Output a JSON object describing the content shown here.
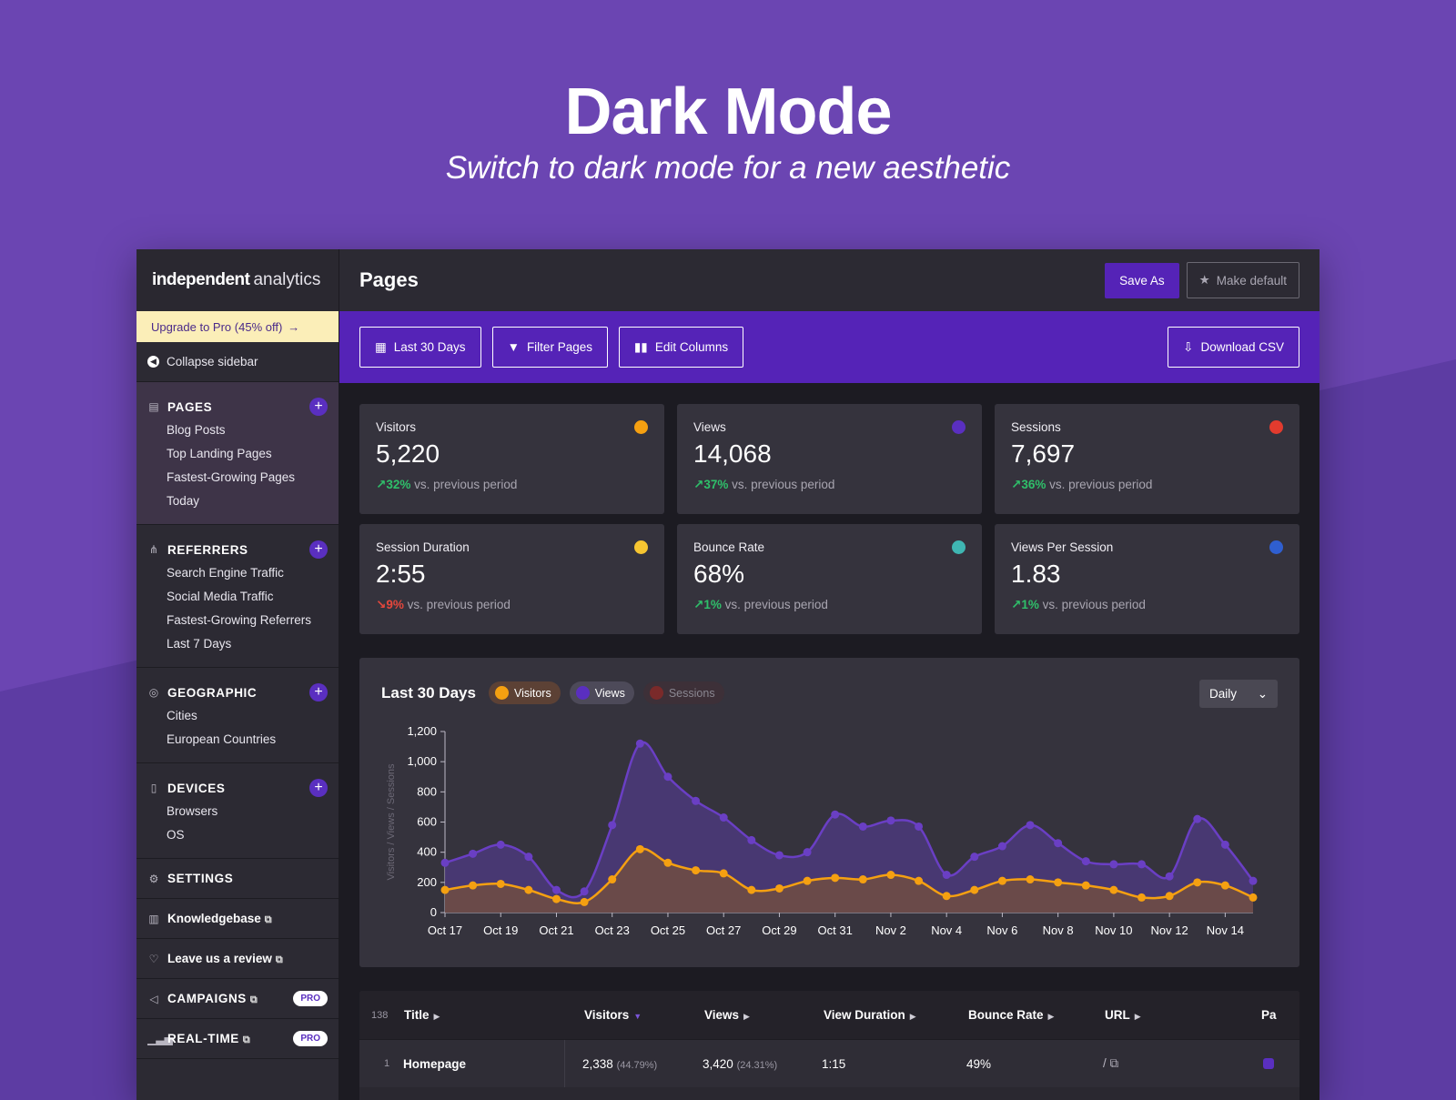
{
  "hero": {
    "title": "Dark Mode",
    "subtitle": "Switch to dark mode for a new aesthetic"
  },
  "sidebar": {
    "logo_bold": "independent",
    "logo_light": "analytics",
    "upgrade": "Upgrade to Pro (45% off)",
    "collapse": "Collapse sidebar",
    "sections": [
      {
        "title": "PAGES",
        "icon": "page-icon",
        "items": [
          "Blog Posts",
          "Top Landing Pages",
          "Fastest-Growing Pages",
          "Today"
        ]
      },
      {
        "title": "REFERRERS",
        "icon": "referrers-icon",
        "items": [
          "Search Engine Traffic",
          "Social Media Traffic",
          "Fastest-Growing Referrers",
          "Last 7 Days"
        ]
      },
      {
        "title": "GEOGRAPHIC",
        "icon": "globe-icon",
        "items": [
          "Cities",
          "European Countries"
        ]
      },
      {
        "title": "DEVICES",
        "icon": "devices-icon",
        "items": [
          "Browsers",
          "OS"
        ]
      }
    ],
    "settings": "SETTINGS",
    "knowledgebase": "Knowledgebase",
    "review": "Leave us a review",
    "campaigns": "CAMPAIGNS",
    "realtime": "REAL-TIME",
    "pro_badge": "PRO"
  },
  "header": {
    "title": "Pages",
    "save_as": "Save As",
    "make_default": "Make default"
  },
  "toolbar": {
    "date_range": "Last 30 Days",
    "filter": "Filter Pages",
    "columns": "Edit Columns",
    "download": "Download CSV"
  },
  "stats": [
    {
      "label": "Visitors",
      "value": "5,220",
      "change": "32%",
      "direction": "up",
      "suffix": "vs. previous period",
      "color": "#f5a011"
    },
    {
      "label": "Views",
      "value": "14,068",
      "change": "37%",
      "direction": "up",
      "suffix": "vs. previous period",
      "color": "#5a2fc0"
    },
    {
      "label": "Sessions",
      "value": "7,697",
      "change": "36%",
      "direction": "up",
      "suffix": "vs. previous period",
      "color": "#e23b2e"
    },
    {
      "label": "Session Duration",
      "value": "2:55",
      "change": "9%",
      "direction": "down",
      "suffix": "vs. previous period",
      "color": "#f6c531"
    },
    {
      "label": "Bounce Rate",
      "value": "68%",
      "change": "1%",
      "direction": "up",
      "suffix": "vs. previous period",
      "color": "#3fb6b2"
    },
    {
      "label": "Views Per Session",
      "value": "1.83",
      "change": "1%",
      "direction": "up",
      "suffix": "vs. previous period",
      "color": "#2f5fd0"
    }
  ],
  "chart_panel": {
    "title": "Last 30 Days",
    "legend": [
      {
        "name": "Visitors",
        "color": "#f5a011",
        "bg": "#5c4135",
        "text": "#ffffff",
        "active": true
      },
      {
        "name": "Views",
        "color": "#5a2fc0",
        "bg": "#4d4a59",
        "text": "#ffffff",
        "active": true
      },
      {
        "name": "Sessions",
        "color": "#7a2a2a",
        "bg": "#3d3038",
        "text": "#8a8791",
        "active": false
      }
    ],
    "interval": "Daily"
  },
  "chart_data": {
    "type": "area",
    "ylabel": "Visitors / Views / Sessions",
    "ylim": [
      0,
      1200
    ],
    "yticks": [
      0,
      200,
      400,
      600,
      800,
      1000,
      1200
    ],
    "ytick_labels": [
      "0",
      "200",
      "400",
      "600",
      "800",
      "1,000",
      "1,200"
    ],
    "x": [
      "Oct 17",
      "Oct 18",
      "Oct 19",
      "Oct 20",
      "Oct 21",
      "Oct 22",
      "Oct 23",
      "Oct 24",
      "Oct 25",
      "Oct 26",
      "Oct 27",
      "Oct 28",
      "Oct 29",
      "Oct 30",
      "Oct 31",
      "Nov 1",
      "Nov 2",
      "Nov 3",
      "Nov 4",
      "Nov 5",
      "Nov 6",
      "Nov 7",
      "Nov 8",
      "Nov 9",
      "Nov 10",
      "Nov 11",
      "Nov 12",
      "Nov 13",
      "Nov 14",
      "Nov 15"
    ],
    "xtick_labels": [
      "Oct 17",
      "Oct 19",
      "Oct 21",
      "Oct 23",
      "Oct 25",
      "Oct 27",
      "Oct 29",
      "Oct 31",
      "Nov 2",
      "Nov 4",
      "Nov 6",
      "Nov 8",
      "Nov 10",
      "Nov 12",
      "Nov 14"
    ],
    "series": [
      {
        "name": "Views",
        "color": "#6a3fc4",
        "values": [
          330,
          390,
          450,
          370,
          150,
          140,
          580,
          1120,
          900,
          740,
          630,
          480,
          380,
          400,
          650,
          570,
          610,
          570,
          250,
          370,
          440,
          580,
          460,
          340,
          320,
          320,
          240,
          620,
          450,
          210
        ]
      },
      {
        "name": "Visitors",
        "color": "#f5a011",
        "values": [
          150,
          180,
          190,
          150,
          90,
          70,
          220,
          420,
          330,
          280,
          260,
          150,
          160,
          210,
          230,
          220,
          250,
          210,
          110,
          150,
          210,
          220,
          200,
          180,
          150,
          100,
          110,
          200,
          180,
          100
        ]
      }
    ]
  },
  "table": {
    "count": "138",
    "headers": [
      "Title",
      "Visitors",
      "Views",
      "View Duration",
      "Bounce Rate",
      "URL",
      "Pa"
    ],
    "rows": [
      {
        "index": "1",
        "title": "Homepage",
        "visitors": "2,338",
        "visitors_pct": "(44.79%)",
        "views": "3,420",
        "views_pct": "(24.31%)",
        "duration": "1:15",
        "bounce": "49%",
        "url": "/"
      }
    ]
  }
}
